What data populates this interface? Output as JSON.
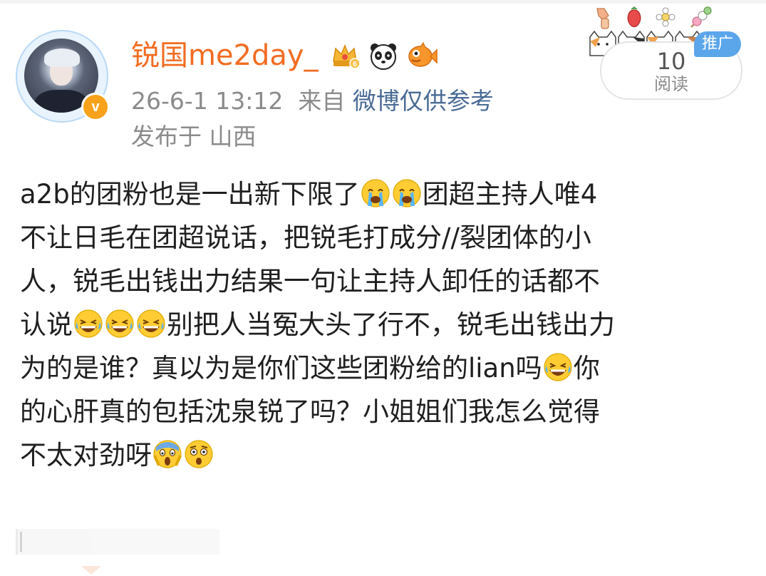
{
  "post": {
    "username": "锐国me2day_",
    "verified_glyph": "v",
    "badges": [
      "crown-badge-icon",
      "panda-badge-icon",
      "fish-badge-icon"
    ],
    "date": "26-6-1 13:12",
    "from_label": "来自",
    "source": "微博仅供参考",
    "location_line": "发布于 山西",
    "read_count": "10",
    "read_label": "阅读",
    "promo_tag": "推广",
    "text_lines": [
      {
        "segments": [
          "a2b的团粉也是一出新下限了",
          "团超主持人唯4"
        ],
        "emojis_after_first": [
          "crying-emoji",
          "crying-emoji"
        ]
      },
      {
        "segments": [
          "不让日毛在团超说话，把锐毛打成分//裂团体的小"
        ]
      },
      {
        "segments": [
          "人，锐毛出钱出力结果一句让主持人卸任的话都不"
        ]
      },
      {
        "segments": [
          "认说",
          "别把人当冤大头了行不，锐毛出钱出力"
        ],
        "emojis_after_first": [
          "laughing-emoji",
          "laughing-emoji",
          "laughing-emoji"
        ]
      },
      {
        "segments": [
          "为的是谁？真以为是你们这些团粉给的lian吗",
          "你"
        ],
        "emojis_after_first": [
          "laughing-emoji"
        ]
      },
      {
        "segments": [
          "的心肝真的包括沈泉锐了吗？小姐姐们我怎么觉得"
        ]
      },
      {
        "segments": [
          "不太对劲呀",
          ""
        ],
        "emojis_after_first": [
          "screaming-emoji",
          "astonished-emoji"
        ]
      }
    ]
  },
  "colors": {
    "username": "#f26c22",
    "source_link": "#4a6b95",
    "meta_text": "#8b8b8b",
    "promo_tag": "#5ba6ea",
    "verified_badge": "#f7a21a"
  }
}
